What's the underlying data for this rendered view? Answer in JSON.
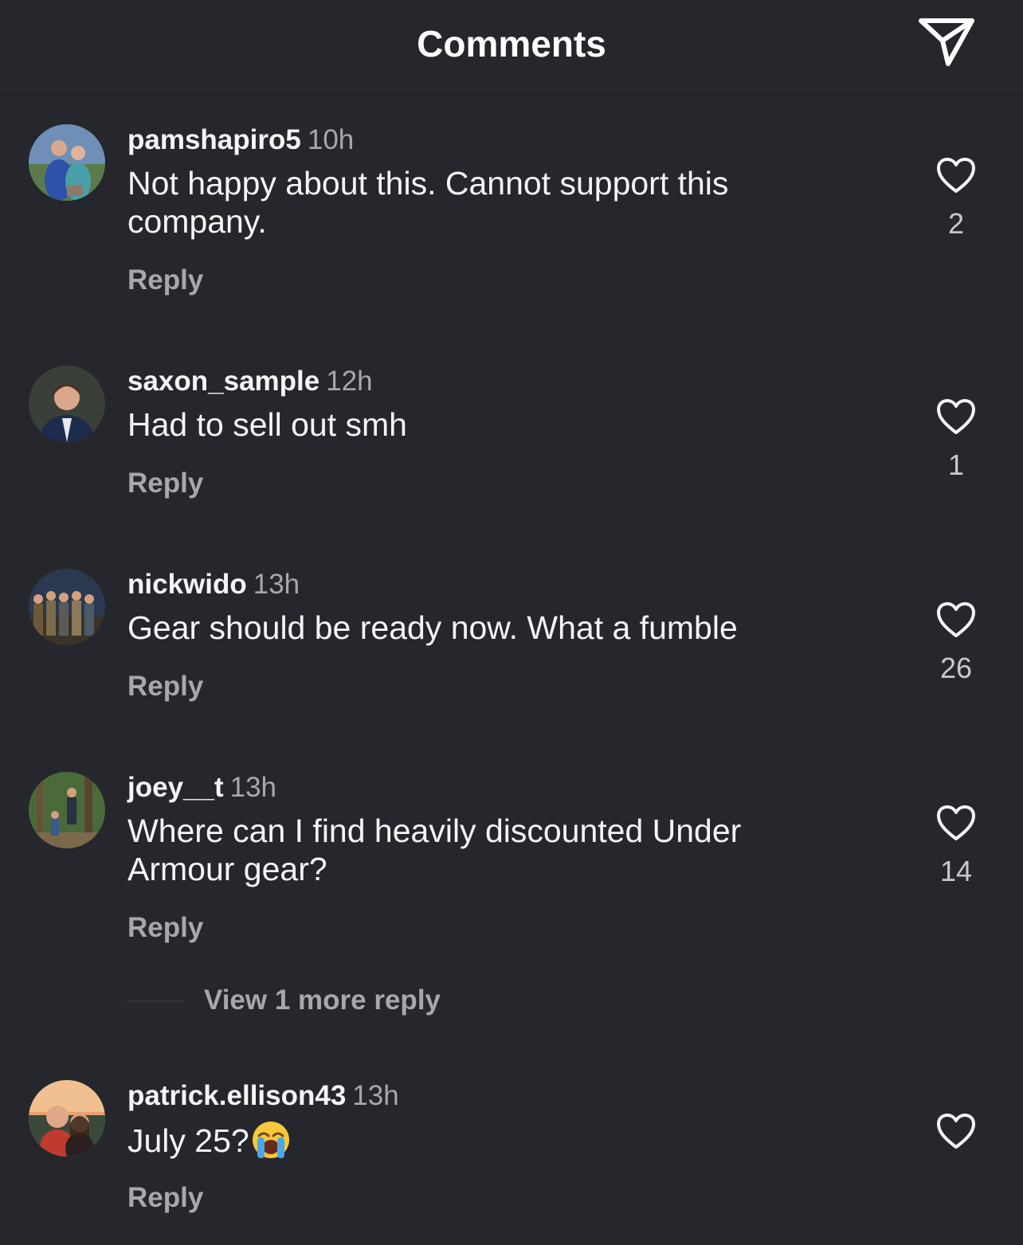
{
  "header": {
    "title": "Comments",
    "share_icon": "paper-plane-icon"
  },
  "reply_label": "Reply",
  "view_more_label": "View 1 more reply",
  "comments": [
    {
      "username": "pamshapiro5",
      "time": "10h",
      "text": "Not happy about this. Cannot support this company.",
      "likes": "2"
    },
    {
      "username": "saxon_sample",
      "time": "12h",
      "text": "Had to sell out smh",
      "likes": "1"
    },
    {
      "username": "nickwido",
      "time": "13h",
      "text": "Gear should be ready now. What a fumble",
      "likes": "26"
    },
    {
      "username": "joey__t",
      "time": "13h",
      "text": "Where can I find heavily discounted Under Armour gear?",
      "likes": "14"
    },
    {
      "username": "patrick.ellison43",
      "time": "13h",
      "text": "July 25?",
      "emoji": "loudly-crying-face-emoji",
      "likes": ""
    }
  ],
  "colors": {
    "background": "#25272d",
    "text": "#f5f5f5",
    "secondary": "#a8a8ac"
  }
}
